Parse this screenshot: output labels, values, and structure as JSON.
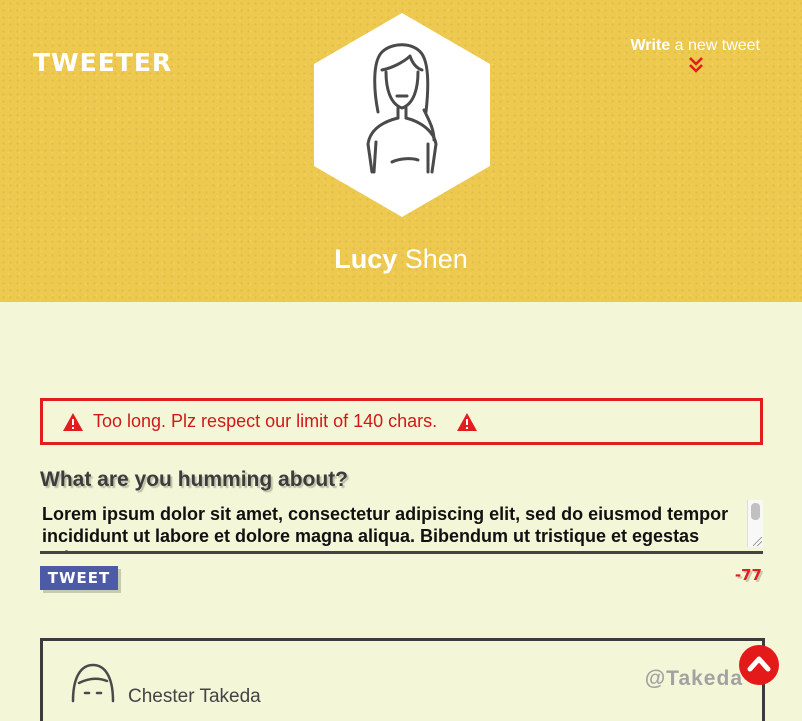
{
  "header": {
    "logo": "TWEETER",
    "write_bold": "Write",
    "write_rest": " a new tweet",
    "profile_first": "Lucy",
    "profile_last": " Shen"
  },
  "error": {
    "message": "Too long. Plz respect our limit of 140 chars."
  },
  "compose": {
    "label": "What are you humming about?",
    "text": "Lorem ipsum dolor sit amet, consectetur adipiscing elit, sed do eiusmod tempor incididunt ut labore et dolore magna aliqua. Bibendum ut tristique et egestas quis",
    "button_label": "TWEET",
    "counter": "-77"
  },
  "tweet": {
    "author": "Chester Takeda",
    "handle": "@Takeda"
  },
  "colors": {
    "header_bg": "#eec94f",
    "page_bg": "#f4f6d8",
    "error_red": "#e11d1d",
    "button_blue": "#4d5aa6"
  },
  "icons": {
    "write_chevron": "double-chevron-down-icon",
    "warning": "warning-triangle-icon",
    "scroll_top": "chevron-up-icon"
  }
}
